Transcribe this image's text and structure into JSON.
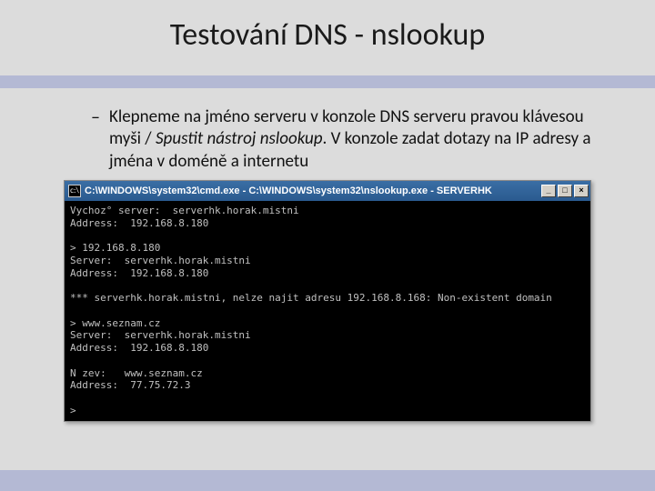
{
  "slide": {
    "title": "Testování DNS - nslookup",
    "bullet_text_1": "Klepneme na jméno serveru v konzole DNS serveru pravou klávesou myši / ",
    "bullet_text_italic": "Spustit nástroj nslookup",
    "bullet_text_2": ". V konzole zadat dotazy na IP adresy a jména v doméně a internetu"
  },
  "cmd": {
    "titlebar": "C:\\WINDOWS\\system32\\cmd.exe - C:\\WINDOWS\\system32\\nslookup.exe - SERVERHK",
    "minimize": "_",
    "maximize": "□",
    "close": "×",
    "output": "Vychoz° server:  serverhk.horak.mistni\nAddress:  192.168.8.180\n\n> 192.168.8.180\nServer:  serverhk.horak.mistni\nAddress:  192.168.8.180\n\n*** serverhk.horak.mistni, nelze najit adresu 192.168.8.168: Non-existent domain\n\n> www.seznam.cz\nServer:  serverhk.horak.mistni\nAddress:  192.168.8.180\n\nN zev:   www.seznam.cz\nAddress:  77.75.72.3\n\n>"
  }
}
